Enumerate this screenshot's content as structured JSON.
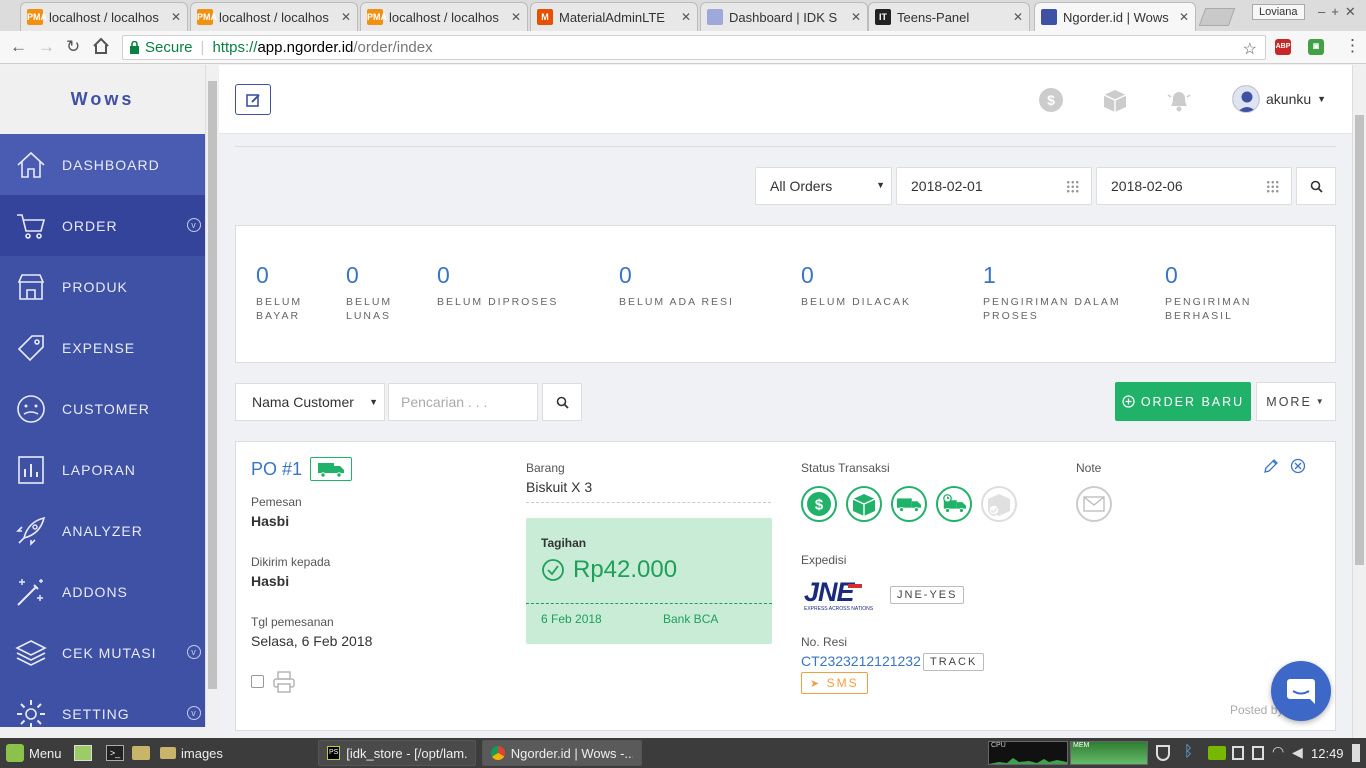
{
  "browser": {
    "tabs": [
      {
        "title": "localhost / localhos",
        "fav_color": "#f29111",
        "fav_text": "PMA"
      },
      {
        "title": "localhost / localhos",
        "fav_color": "#f29111",
        "fav_text": "PMA"
      },
      {
        "title": "localhost / localhos",
        "fav_color": "#f29111",
        "fav_text": "PMA"
      },
      {
        "title": "MaterialAdminLTE",
        "fav_color": "#e65100",
        "fav_text": "M"
      },
      {
        "title": "Dashboard | IDK S",
        "fav_color": "#9fa8da",
        "fav_text": ""
      },
      {
        "title": "Teens-Panel",
        "fav_color": "#222222",
        "fav_text": "IT"
      },
      {
        "title": "Ngorder.id | Wows",
        "fav_color": "#3f51a5",
        "fav_text": ""
      }
    ],
    "profile": "Loviana",
    "secure_label": "Secure",
    "url_scheme": "https://",
    "url_host": "app.ngorder.id",
    "url_path": "/order/index"
  },
  "sidebar": {
    "brand": "Wows",
    "items": [
      {
        "label": "DASHBOARD",
        "icon": "home-icon"
      },
      {
        "label": "ORDER",
        "icon": "cart-icon"
      },
      {
        "label": "PRODUK",
        "icon": "store-icon"
      },
      {
        "label": "EXPENSE",
        "icon": "tag-icon"
      },
      {
        "label": "CUSTOMER",
        "icon": "customer-face-icon"
      },
      {
        "label": "LAPORAN",
        "icon": "report-chart-icon"
      },
      {
        "label": "ANALYZER",
        "icon": "rocket-icon"
      },
      {
        "label": "ADDONS",
        "icon": "magic-wand-icon"
      },
      {
        "label": "CEK MUTASI",
        "icon": "layers-icon"
      },
      {
        "label": "SETTING",
        "icon": "gear-icon"
      }
    ]
  },
  "header": {
    "username": "akunku"
  },
  "filters": {
    "order_type": "All Orders",
    "date_from": "2018-02-01",
    "date_to": "2018-02-06"
  },
  "stats": [
    {
      "value": "0",
      "label": "BELUM\nBAYAR"
    },
    {
      "value": "0",
      "label": "BELUM\nLUNAS"
    },
    {
      "value": "0",
      "label": "BELUM DIPROSES"
    },
    {
      "value": "0",
      "label": "BELUM ADA RESI"
    },
    {
      "value": "0",
      "label": "BELUM DILACAK"
    },
    {
      "value": "1",
      "label": "PENGIRIMAN DALAM\nPROSES"
    },
    {
      "value": "0",
      "label": "PENGIRIMAN\nBERHASIL"
    }
  ],
  "search": {
    "field": "Nama Customer",
    "placeholder": "Pencarian . . ."
  },
  "actions": {
    "new_order": "ORDER BARU",
    "more": "MORE"
  },
  "order": {
    "po": "PO #1",
    "pemesan_label": "Pemesan",
    "pemesan": "Hasbi",
    "dikirim_label": "Dikirim kepada",
    "dikirim": "Hasbi",
    "tgl_label": "Tgl pemesanan",
    "tgl": "Selasa, 6 Feb 2018",
    "barang_label": "Barang",
    "barang": "Biskuit X 3",
    "tagihan_label": "Tagihan",
    "tagihan": "Rp42.000",
    "tagihan_date": "6 Feb 2018",
    "tagihan_bank": "Bank BCA",
    "status_label": "Status Transaksi",
    "note_label": "Note",
    "expedisi_label": "Expedisi",
    "expedisi_logo": "JNE",
    "expedisi_tagline": "EXPRESS ACROSS NATIONS",
    "expedisi_service": "JNE-YES",
    "resi_label": "No. Resi",
    "resi": "CT2323212121232",
    "track": "TRACK",
    "sms": "SMS",
    "posted": "Posted by"
  },
  "taskbar": {
    "menu": "Menu",
    "folder": "images",
    "win1": "[idk_store - [/opt/lam...",
    "win2": "Ngorder.id | Wows -...",
    "cpu": "CPU",
    "mem": "MEM",
    "clock": "12:49"
  },
  "colors": {
    "primary": "#3f51a5",
    "success": "#21b26a",
    "link": "#3a75c4"
  }
}
